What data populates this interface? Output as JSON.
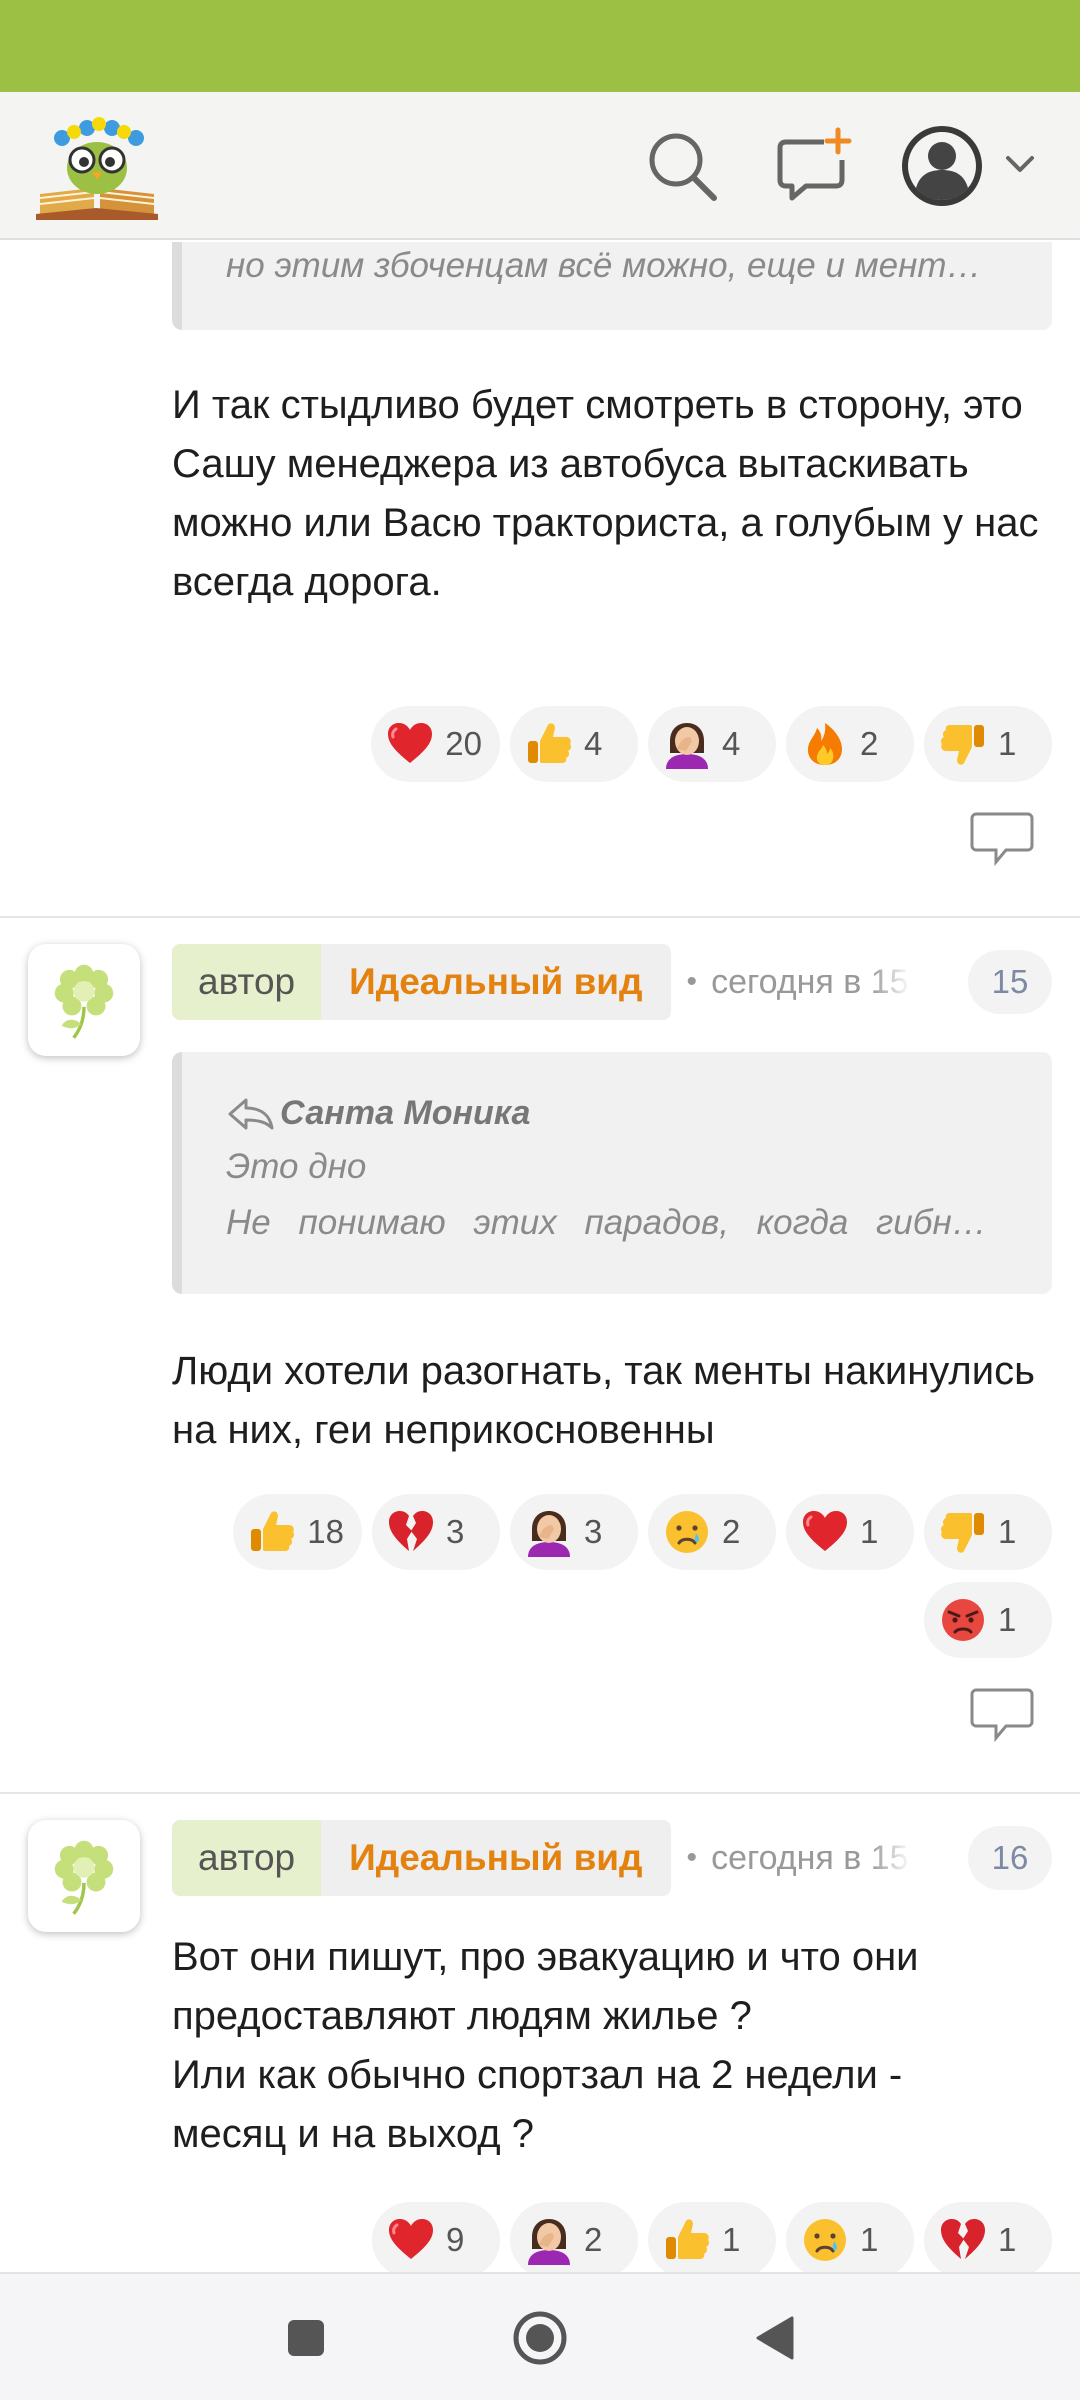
{
  "header": {
    "logo": "owl-on-book-logo",
    "icons": [
      "search-icon",
      "new-post-icon",
      "user-avatar-icon",
      "chevron-down-icon"
    ]
  },
  "comments": [
    {
      "quote_tail": "но этим збоченцам всё можно, еще и мент…",
      "text": "И так стыдливо будет смотреть в сторону, это Сашу менеджера из автобуса вытаскивать можно или Васю тракториста, а голубым у нас всегда дорога.",
      "reactions": [
        {
          "emoji": "heart",
          "count": "20"
        },
        {
          "emoji": "thumbs-up",
          "count": "4"
        },
        {
          "emoji": "facepalm",
          "count": "4"
        },
        {
          "emoji": "fire",
          "count": "2"
        },
        {
          "emoji": "thumbs-down",
          "count": "1"
        }
      ]
    },
    {
      "author_label": "автор",
      "author_name": "Идеальный вид",
      "time": "сегодня в 15:",
      "number": "15",
      "quote_author": "Санта Моника",
      "quote_line1": "Это дно",
      "quote_line2": "Не понимаю этих парадов, когда гибн…",
      "text": "Люди хотели разогнать, так менты накинулись на них, геи неприкосновенны",
      "reactions": [
        {
          "emoji": "thumbs-up",
          "count": "18"
        },
        {
          "emoji": "broken-heart",
          "count": "3"
        },
        {
          "emoji": "facepalm",
          "count": "3"
        },
        {
          "emoji": "crying",
          "count": "2"
        },
        {
          "emoji": "heart",
          "count": "1"
        },
        {
          "emoji": "thumbs-down",
          "count": "1"
        }
      ],
      "reactions_row2": [
        {
          "emoji": "angry",
          "count": "1"
        }
      ]
    },
    {
      "author_label": "автор",
      "author_name": "Идеальный вид",
      "time": "сегодня в 15:",
      "number": "16",
      "text_lines": [
        "Вот они пишут, про эвакуацию и что они",
        "предоставляют людям жилье ?",
        "Или как обычно спортзал на 2 недели -",
        "месяц и на выход ?"
      ],
      "reactions": [
        {
          "emoji": "heart",
          "count": "9"
        },
        {
          "emoji": "facepalm",
          "count": "2"
        },
        {
          "emoji": "thumbs-up",
          "count": "1"
        },
        {
          "emoji": "crying",
          "count": "1"
        },
        {
          "emoji": "broken-heart",
          "count": "1"
        }
      ]
    }
  ],
  "colors": {
    "status_bar": "#9bc043",
    "author_name": "#e3820f",
    "author_label_bg": "#e6f0cc"
  },
  "nav": [
    "recent-apps-icon",
    "home-icon",
    "back-icon"
  ]
}
